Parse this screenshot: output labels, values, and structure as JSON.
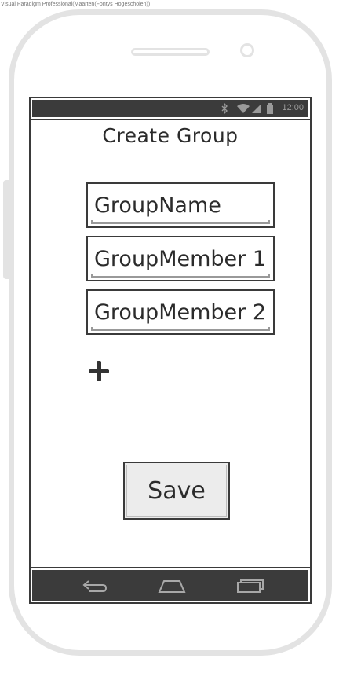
{
  "watermark": "Visual Paradigm Professional(Maarten(Fontys Hogescholen))",
  "status_bar": {
    "time": "12:00",
    "icons": [
      "bluetooth-icon",
      "wifi-icon",
      "signal-icon",
      "battery-icon"
    ],
    "background": "#3b3b3b"
  },
  "screen": {
    "title": "Create Group",
    "fields": [
      {
        "name": "group-name",
        "value": "GroupName"
      },
      {
        "name": "group-member-1",
        "value": "GroupMember 1"
      },
      {
        "name": "group-member-2",
        "value": "GroupMember 2"
      }
    ],
    "add_icon": "plus-icon",
    "save_label": "Save"
  },
  "nav_bar": {
    "buttons": [
      "back-icon",
      "home-icon",
      "recent-apps-icon"
    ],
    "background": "#3b3b3b"
  }
}
